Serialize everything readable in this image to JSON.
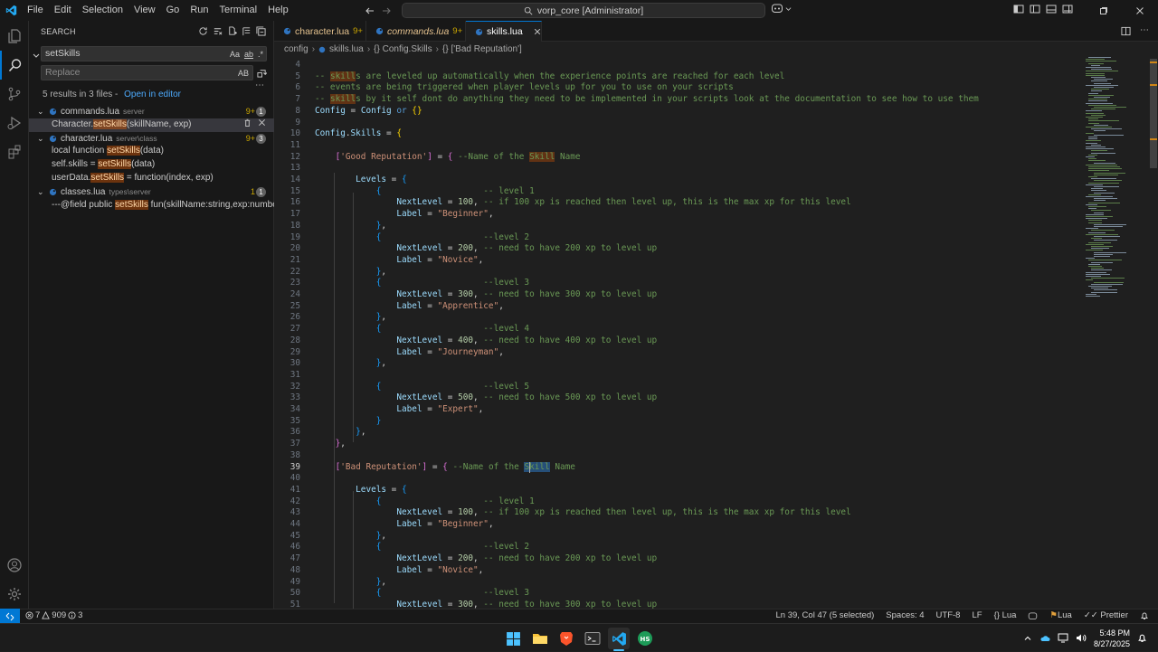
{
  "titlebar": {
    "menus": [
      "File",
      "Edit",
      "Selection",
      "View",
      "Go",
      "Run",
      "Terminal",
      "Help"
    ],
    "command_center": "vorp_core [Administrator]"
  },
  "sidebar": {
    "title": "SEARCH",
    "search_value": "setSkills",
    "search_options": [
      "Aa",
      "ab",
      ".*"
    ],
    "replace_placeholder": "Replace",
    "replace_option": "AB",
    "summary": "5 results in 3 files - ",
    "open_in_editor": "Open in editor",
    "files": [
      {
        "name": "commands.lua",
        "path": "server",
        "count": "9+",
        "badge": "1",
        "matches": [
          {
            "pre": "Character.",
            "hit": "setSkills",
            "post": "(skillName, exp)"
          }
        ]
      },
      {
        "name": "character.lua",
        "path": "server\\class",
        "count": "9+",
        "badge": "3",
        "matches": [
          {
            "pre": "local function ",
            "hit": "setSkills",
            "post": "(data)"
          },
          {
            "pre": "self.skills = ",
            "hit": "setSkills",
            "post": "(data)"
          },
          {
            "pre": "userData.",
            "hit": "setSkills",
            "post": " = function(index, exp)"
          }
        ]
      },
      {
        "name": "classes.lua",
        "path": "types\\server",
        "count": "1",
        "badge": "1",
        "matches": [
          {
            "pre": "---@field public ",
            "hit": "setSkills",
            "post": " fun(skillName:string,exp:number)"
          }
        ]
      }
    ]
  },
  "tabs": [
    {
      "label": "character.lua",
      "mod": "9+"
    },
    {
      "label": "commands.lua",
      "mod": "9+"
    },
    {
      "label": "skills.lua",
      "mod": ""
    }
  ],
  "breadcrumb": [
    "config",
    "skills.lua",
    "{} Config.Skills",
    "{} ['Bad Reputation']"
  ],
  "editor": {
    "line_numbers": [
      "4",
      "5",
      "6",
      "7",
      "8",
      "9",
      "10",
      "11",
      "12",
      "13",
      "14",
      "15",
      "16",
      "17",
      "18",
      "19",
      "20",
      "21",
      "22",
      "23",
      "24",
      "25",
      "26",
      "27",
      "28",
      "29",
      "30",
      "31",
      "32",
      "33",
      "34",
      "35",
      "36",
      "37",
      "38",
      "39",
      "40",
      "41",
      "42",
      "43",
      "44",
      "45",
      "46",
      "47",
      "48",
      "49",
      "50",
      "51"
    ],
    "current_line": "39"
  },
  "statusbar": {
    "errors": "7",
    "warnings": "909",
    "infos": "3",
    "position": "Ln 39, Col 47 (5 selected)",
    "spaces": "Spaces: 4",
    "encoding": "UTF-8",
    "eol": "LF",
    "language": "Lua",
    "lua_status": "Lua",
    "prettier": "Prettier"
  },
  "taskbar": {
    "time": "5:48 PM",
    "date": "8/27/2025"
  },
  "colors": {
    "accent": "#0078d4",
    "comment": "#6a9955",
    "string": "#ce9178",
    "number": "#b5cea8",
    "variable": "#9cdcfe",
    "bracket1": "#ffd700",
    "bracket2": "#da70d6",
    "bracket3": "#179fff"
  }
}
